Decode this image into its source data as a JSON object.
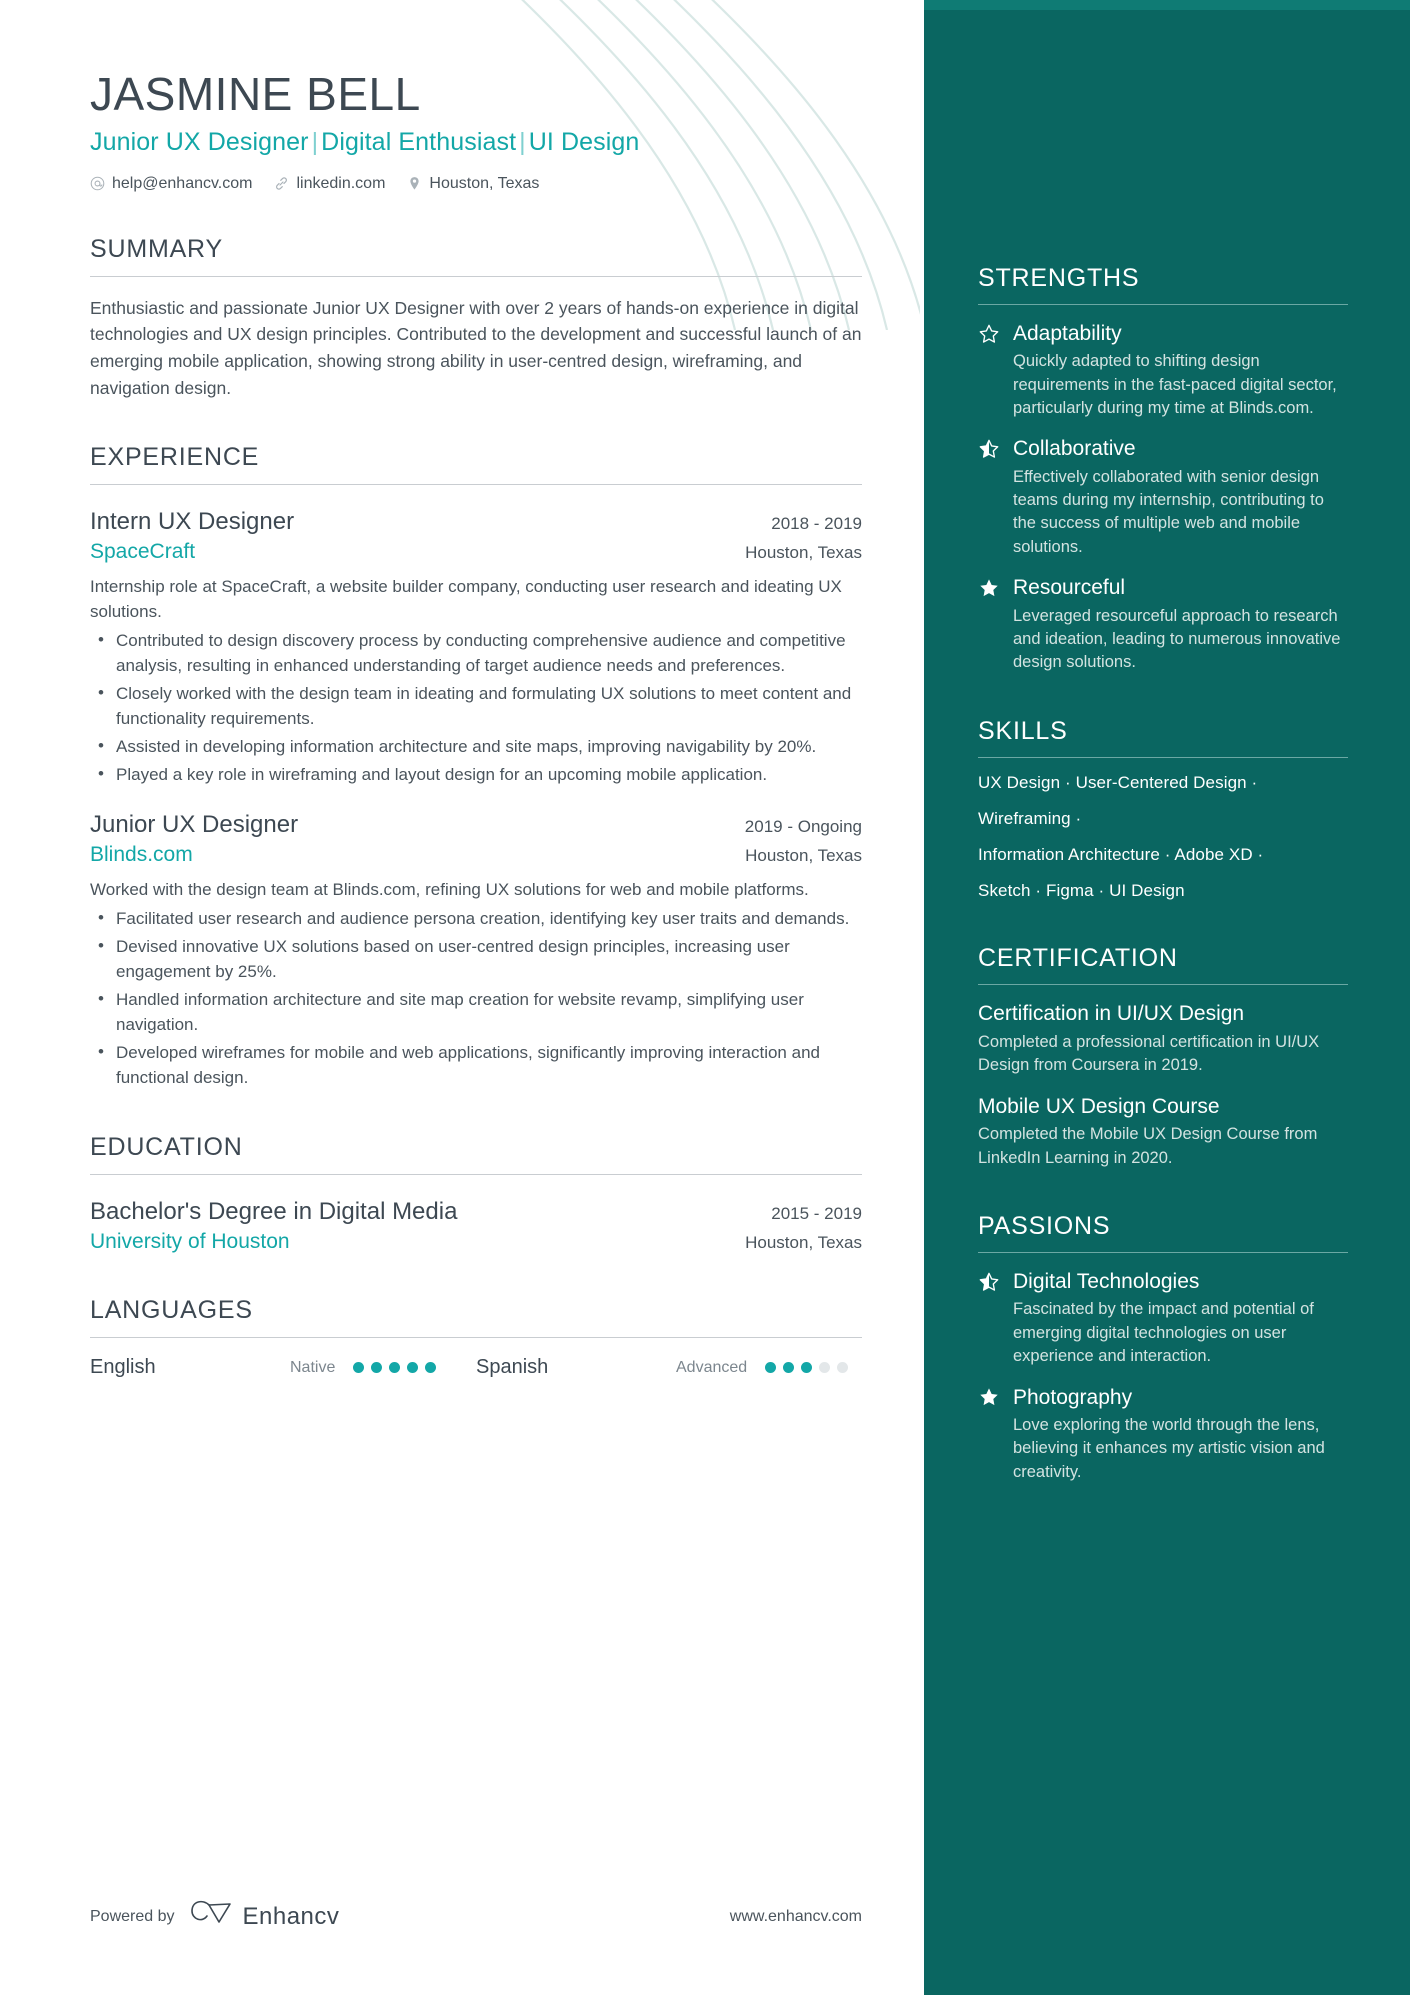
{
  "theme": {
    "accent_teal": "#13a7a7",
    "sidebar_bg": "#0a6661",
    "heading_gray": "#3d4852",
    "body_gray": "#4a545c"
  },
  "header": {
    "name": "JASMINE BELL",
    "headline_parts": [
      "Junior UX Designer",
      "Digital Enthusiast",
      "UI Design"
    ],
    "headline_separator": "|",
    "contacts": [
      {
        "icon": "at-icon",
        "text": "help@enhancv.com"
      },
      {
        "icon": "link-icon",
        "text": "linkedin.com"
      },
      {
        "icon": "location-pin-icon",
        "text": "Houston, Texas"
      }
    ]
  },
  "summary": {
    "title": "SUMMARY",
    "text": "Enthusiastic and passionate Junior UX Designer with over 2 years of hands-on experience in digital technologies and UX design principles. Contributed to the development and successful launch of an emerging mobile application, showing strong ability in user-centred design, wireframing, and navigation design."
  },
  "experience": {
    "title": "EXPERIENCE",
    "entries": [
      {
        "role": "Intern UX Designer",
        "date": "2018 - 2019",
        "company": "SpaceCraft",
        "location": "Houston, Texas",
        "description": "Internship role at SpaceCraft, a website builder company, conducting user research and ideating UX solutions.",
        "bullets": [
          "Contributed to design discovery process by conducting comprehensive audience and competitive analysis, resulting in enhanced understanding of target audience needs and preferences.",
          "Closely worked with the design team in ideating and formulating UX solutions to meet content and functionality requirements.",
          "Assisted in developing information architecture and site maps, improving navigability by 20%.",
          "Played a key role in wireframing and layout design for an upcoming mobile application."
        ]
      },
      {
        "role": "Junior UX Designer",
        "date": "2019 - Ongoing",
        "company": "Blinds.com",
        "location": "Houston, Texas",
        "description": "Worked with the design team at Blinds.com, refining UX solutions for web and mobile platforms.",
        "bullets": [
          "Facilitated user research and audience persona creation, identifying key user traits and demands.",
          "Devised innovative UX solutions based on user-centred design principles, increasing user engagement by 25%.",
          "Handled information architecture and site map creation for website revamp, simplifying user navigation.",
          "Developed wireframes for mobile and web applications, significantly improving interaction and functional design."
        ]
      }
    ]
  },
  "education": {
    "title": "EDUCATION",
    "entries": [
      {
        "degree": "Bachelor's Degree in Digital Media",
        "date": "2015 - 2019",
        "school": "University of Houston",
        "location": "Houston, Texas"
      }
    ]
  },
  "languages": {
    "title": "LANGUAGES",
    "items": [
      {
        "name": "English",
        "level": "Native",
        "filled": 5,
        "total": 5
      },
      {
        "name": "Spanish",
        "level": "Advanced",
        "filled": 3,
        "total": 5
      }
    ]
  },
  "strengths": {
    "title": "STRENGTHS",
    "items": [
      {
        "icon": "star-outline-icon",
        "title": "Adaptability",
        "text": "Quickly adapted to shifting design requirements in the fast-paced digital sector, particularly during my time at Blinds.com."
      },
      {
        "icon": "star-half-icon",
        "title": "Collaborative",
        "text": "Effectively collaborated with senior design teams during my internship, contributing to the success of multiple web and mobile solutions."
      },
      {
        "icon": "star-filled-icon",
        "title": "Resourceful",
        "text": "Leveraged resourceful approach to research and ideation, leading to numerous innovative design solutions."
      }
    ]
  },
  "skills": {
    "title": "SKILLS",
    "lines": [
      "UX Design · User-Centered Design ·",
      "Wireframing ·",
      "Information Architecture · Adobe XD ·",
      "Sketch · Figma · UI Design"
    ]
  },
  "certification": {
    "title": "CERTIFICATION",
    "items": [
      {
        "title": "Certification in UI/UX Design",
        "text": "Completed a professional certification in UI/UX Design from Coursera in 2019."
      },
      {
        "title": "Mobile UX Design Course",
        "text": "Completed the Mobile UX Design Course from LinkedIn Learning in 2020."
      }
    ]
  },
  "passions": {
    "title": "PASSIONS",
    "items": [
      {
        "icon": "star-half-icon",
        "title": "Digital Technologies",
        "text": "Fascinated by the impact and potential of emerging digital technologies on user experience and interaction."
      },
      {
        "icon": "star-filled-icon",
        "title": "Photography",
        "text": "Love exploring the world through the lens, believing it enhances my artistic vision and creativity."
      }
    ]
  },
  "footer": {
    "powered_by": "Powered by",
    "brand": "Enhancv",
    "url": "www.enhancv.com"
  }
}
